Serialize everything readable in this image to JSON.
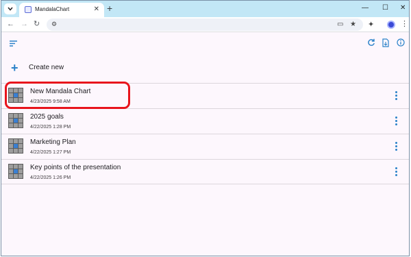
{
  "browser": {
    "tab_title": "MandalaChart",
    "tab_close": "✕",
    "new_tab": "+",
    "controls": {
      "minimize": "—",
      "maximize": "☐",
      "close": "✕"
    }
  },
  "app": {
    "create_label": "Create new",
    "items": [
      {
        "title": "New Mandala Chart",
        "date": "4/23/2025 9:58 AM"
      },
      {
        "title": "2025 goals",
        "date": "4/22/2025 1:28 PM"
      },
      {
        "title": "Marketing Plan",
        "date": "4/22/2025 1:27 PM"
      },
      {
        "title": "Key points of the presentation",
        "date": "4/22/2025 1:26 PM"
      }
    ]
  },
  "colors": {
    "accent": "#2b82c9",
    "thumb_center": "#3a7fd2",
    "highlight": "#e8141c",
    "tabstrip": "#c2e7f6"
  },
  "icons": {
    "sort": "sort-icon",
    "refresh": "refresh-icon",
    "export": "export-file-icon",
    "info": "info-icon",
    "row_menu": "more-vert-icon"
  }
}
